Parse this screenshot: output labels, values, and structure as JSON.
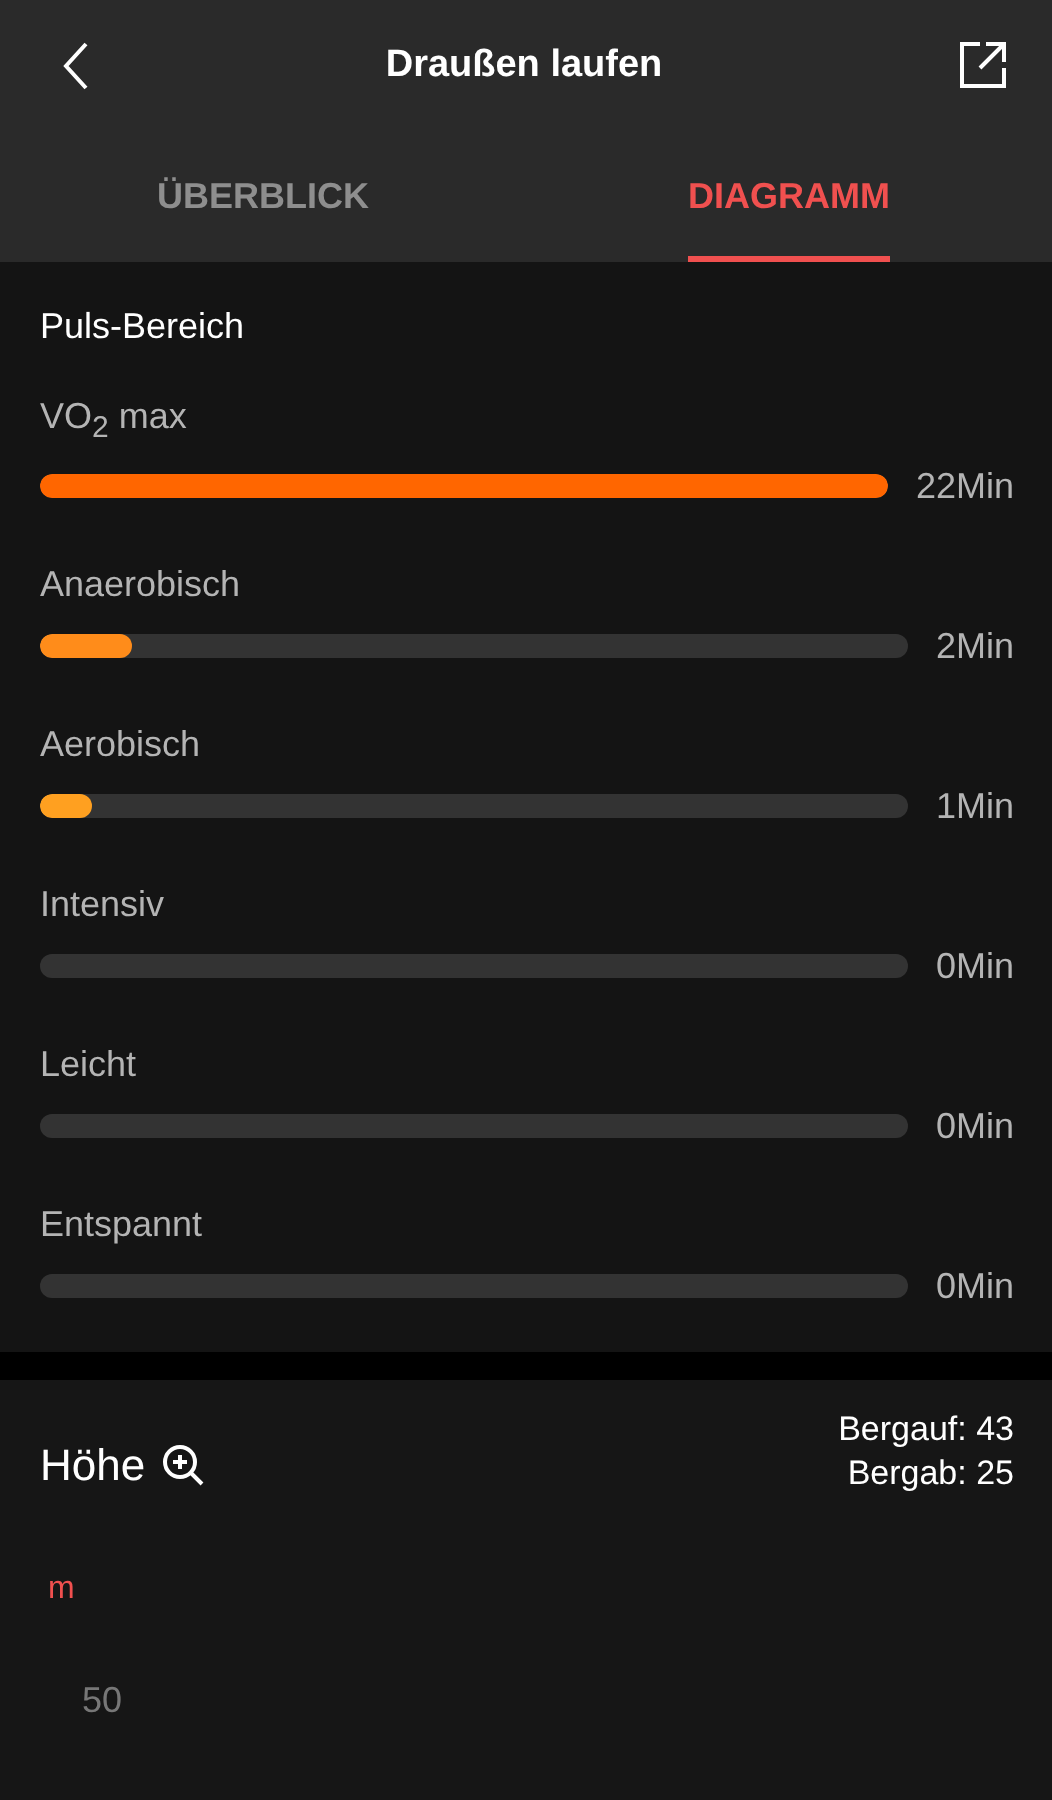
{
  "header": {
    "title": "Draußen laufen"
  },
  "tabs": [
    {
      "label": "ÜBERBLICK",
      "selected": false
    },
    {
      "label": "DIAGRAMM",
      "selected": true
    }
  ],
  "heart_rate": {
    "title": "Puls-Bereich",
    "zones": [
      {
        "name": "VO$_{2}$ max",
        "level": 1,
        "reading": "22Min",
        "color": "#ff6600"
      },
      {
        "name": "Anaerobisch",
        "level": 0.105,
        "reading": "2Min",
        "color": "#ff8c1a"
      },
      {
        "name": "Aerobisch",
        "level": 0.06,
        "reading": "1Min",
        "color": "#ffa020"
      },
      {
        "name": "Intensiv",
        "reading": "0Min"
      },
      {
        "name": "Leicht",
        "reading": "0Min"
      },
      {
        "name": "Entspannt",
        "reading": "0Min"
      }
    ]
  },
  "altitude": {
    "title": "Höhe",
    "uphill": "Bergauf: 43",
    "downhill": "Bergab: 25",
    "unit": "m",
    "tick": "50"
  }
}
